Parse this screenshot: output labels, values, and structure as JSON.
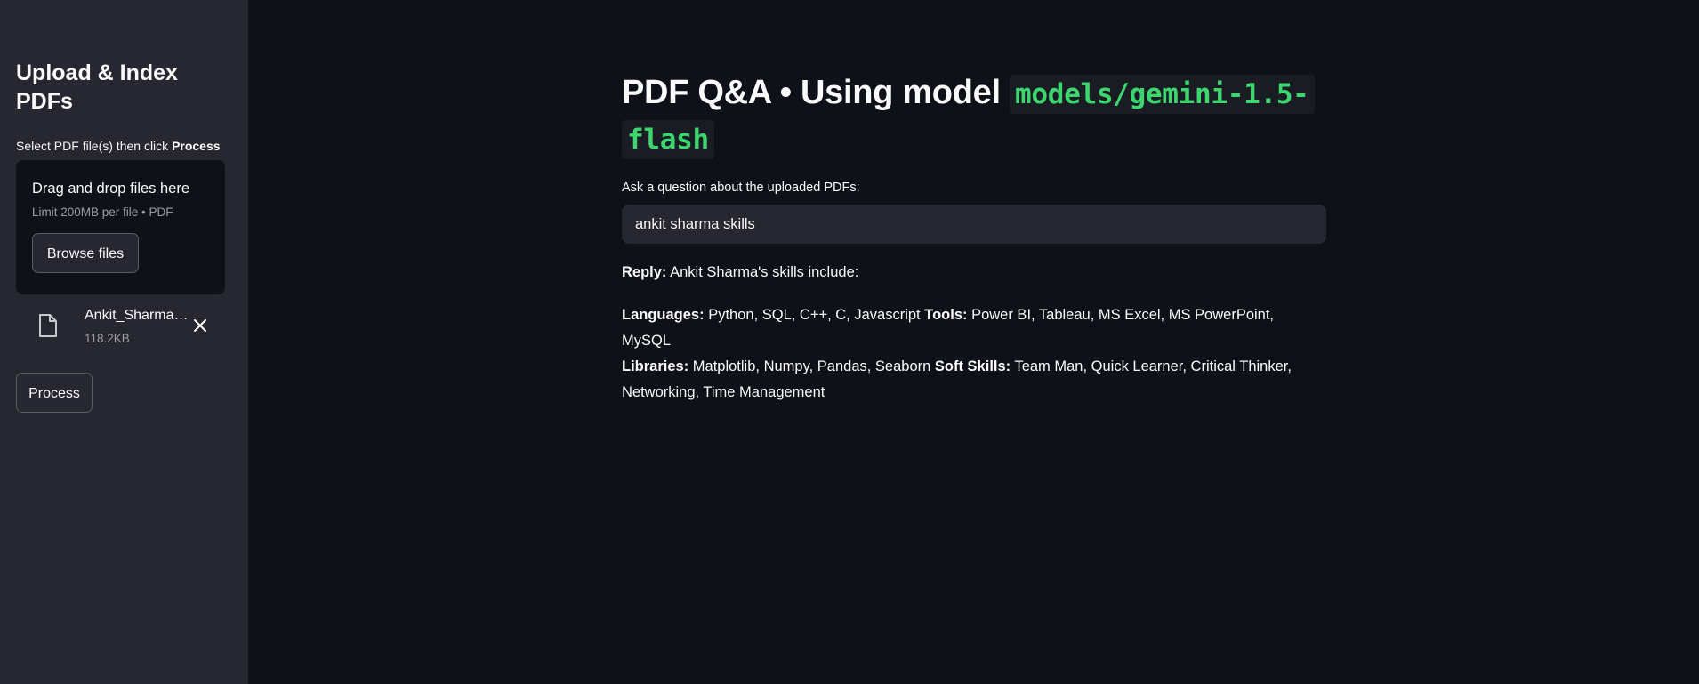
{
  "sidebar": {
    "title": "Upload & Index PDFs",
    "instruction_prefix": "Select PDF file(s) then click ",
    "instruction_bold": "Process",
    "dropzone": {
      "title": "Drag and drop files here",
      "limit": "Limit 200MB per file • PDF",
      "browse_label": "Browse files"
    },
    "file": {
      "name": "Ankit_Sharma_Resume.pdf",
      "size": "118.2KB",
      "icon": "file-icon",
      "remove_icon": "close-icon"
    },
    "process_label": "Process"
  },
  "main": {
    "title_text": "PDF Q&A • Using model ",
    "title_code": "models/gemini-1.5-flash",
    "question_label": "Ask a question about the uploaded PDFs:",
    "question_value": "ankit sharma skills",
    "reply_label": "Reply:",
    "reply_text": " Ankit Sharma's skills include:",
    "answer": [
      {
        "label": "Languages:",
        "text": " Python, SQL, C++, C, Javascript "
      },
      {
        "label": "Tools:",
        "text": " Power BI, Tableau, MS Excel, MS PowerPoint, MySQL "
      },
      {
        "label": "Libraries:",
        "text": " Matplotlib, Numpy, Pandas, Seaborn "
      },
      {
        "label": "Soft Skills:",
        "text": " Team Man, Quick Learner, Critical Thinker, Networking, Time Management"
      }
    ]
  },
  "colors": {
    "background": "#0e1117",
    "sidebar": "#262730",
    "code_green": "#3dd56d"
  }
}
